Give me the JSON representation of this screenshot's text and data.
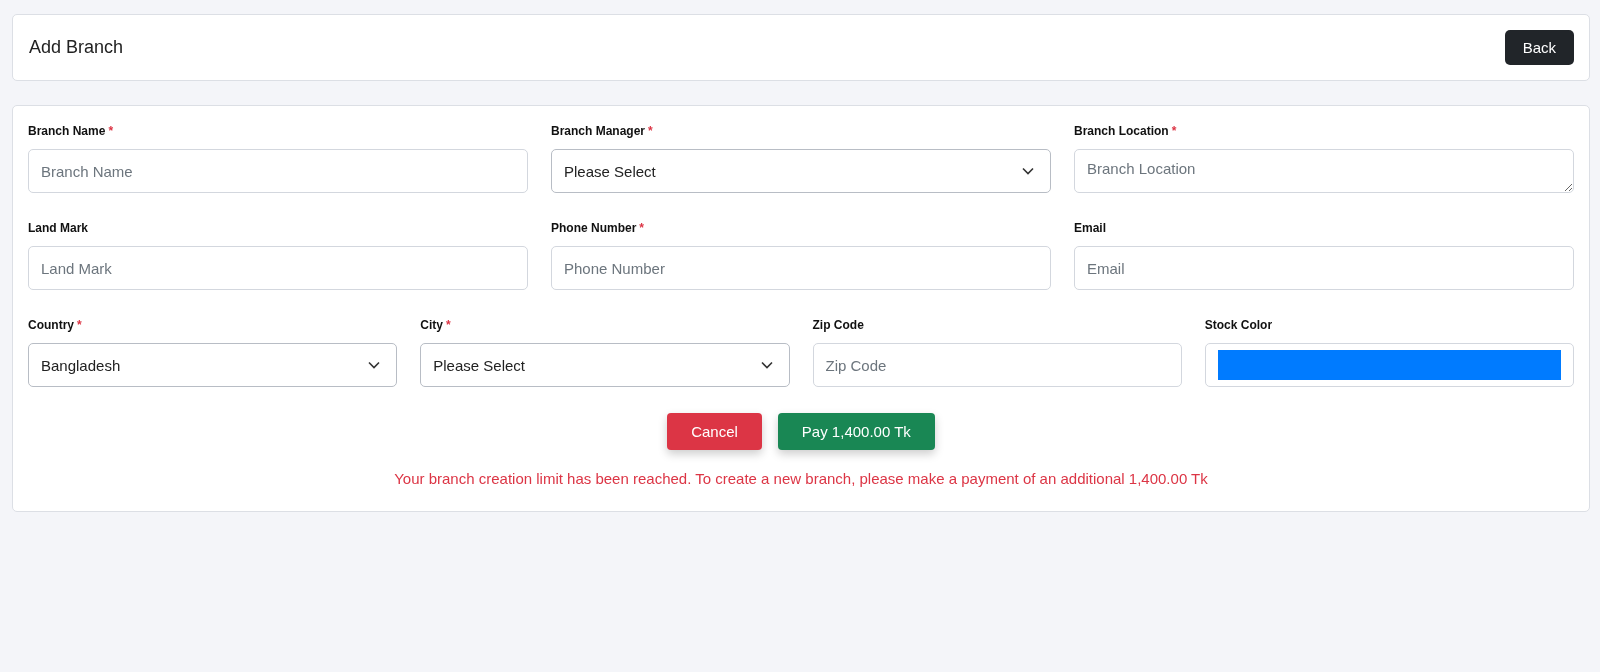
{
  "header": {
    "title": "Add Branch",
    "back_button": "Back"
  },
  "form": {
    "rows": [
      [
        {
          "label": "Branch Name",
          "required_mark": "*",
          "kind": "text",
          "placeholder": "Branch Name"
        },
        {
          "label": "Branch Manager",
          "required_mark": "*",
          "kind": "select",
          "value": "Please Select"
        },
        {
          "label": "Branch Location",
          "required_mark": "*",
          "kind": "textarea",
          "placeholder": "Branch Location"
        }
      ],
      [
        {
          "label": "Land Mark",
          "kind": "text",
          "placeholder": "Land Mark"
        },
        {
          "label": "Phone Number",
          "required_mark": "*",
          "kind": "text",
          "placeholder": "Phone Number"
        },
        {
          "label": "Email",
          "kind": "text",
          "placeholder": "Email"
        }
      ],
      [
        {
          "label": "Country",
          "required_mark": "*",
          "kind": "select",
          "value": "Bangladesh"
        },
        {
          "label": "City",
          "required_mark": "*",
          "kind": "select",
          "value": "Please Select"
        },
        {
          "label": "Zip Code",
          "kind": "text",
          "placeholder": "Zip Code"
        },
        {
          "label": "Stock Color",
          "kind": "color",
          "color": "#007bff"
        }
      ]
    ],
    "actions": [
      {
        "label": "Cancel",
        "kind": "cancel"
      },
      {
        "label": "Pay 1,400.00 Tk",
        "kind": "pay"
      }
    ],
    "message": "Your branch creation limit has been reached. To create a new branch, please make a payment of an additional 1,400.00 Tk"
  }
}
